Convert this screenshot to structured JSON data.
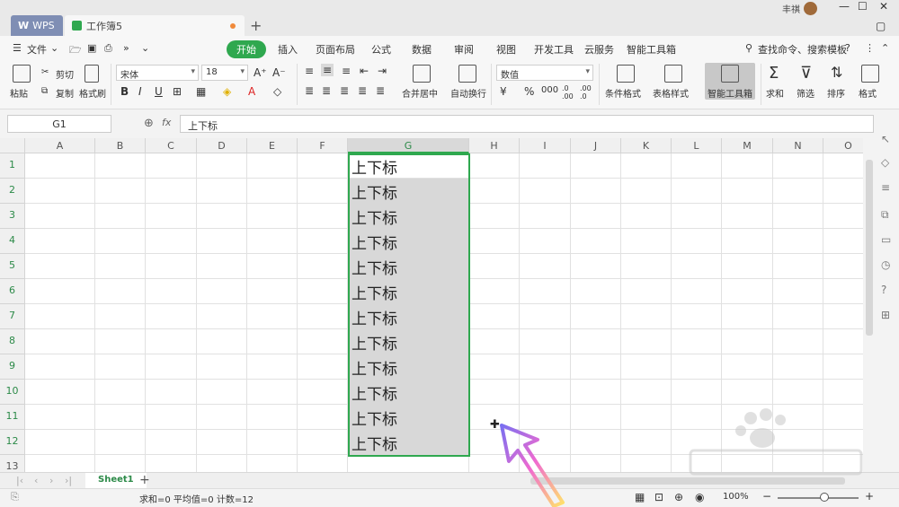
{
  "titlebar": {
    "wps_tab": "WPS",
    "doc_tab": "工作簿5",
    "user_name": "丰祺"
  },
  "menu": {
    "file": "文件",
    "items": [
      "开始",
      "插入",
      "页面布局",
      "公式",
      "数据",
      "审阅",
      "视图",
      "开发工具",
      "云服务",
      "智能工具箱"
    ],
    "search": "查找命令、搜索模板"
  },
  "ribbon": {
    "paste": "粘贴",
    "cut": "剪切",
    "copy": "复制",
    "format_painter": "格式刷",
    "font_name": "宋体",
    "font_size": "18",
    "merge": "合并居中",
    "wrap": "自动换行",
    "number_format": "数值",
    "cond_format": "条件格式",
    "table_style": "表格样式",
    "smart_tools": "智能工具箱",
    "sum": "求和",
    "filter": "筛选",
    "sort": "排序",
    "format": "格式"
  },
  "formula_bar": {
    "name_box": "G1",
    "fx": "fx",
    "value": "上下标"
  },
  "grid": {
    "columns": [
      "A",
      "B",
      "C",
      "D",
      "E",
      "F",
      "G",
      "H",
      "I",
      "J",
      "K",
      "L",
      "M",
      "N",
      "O"
    ],
    "rows": [
      "1",
      "2",
      "3",
      "4",
      "5",
      "6",
      "7",
      "8",
      "9",
      "10",
      "11",
      "12",
      "13"
    ],
    "g_cells": [
      "上下标",
      "上下标",
      "上下标",
      "上下标",
      "上下标",
      "上下标",
      "上下标",
      "上下标",
      "上下标",
      "上下标",
      "上下标",
      "上下标"
    ]
  },
  "sheets": {
    "active": "Sheet1",
    "add": "+"
  },
  "status": {
    "summary": "求和=0  平均值=0  计数=12",
    "zoom": "100%"
  },
  "colors": {
    "accent": "#2fa84f",
    "selection_fill": "#d8d8d8"
  }
}
